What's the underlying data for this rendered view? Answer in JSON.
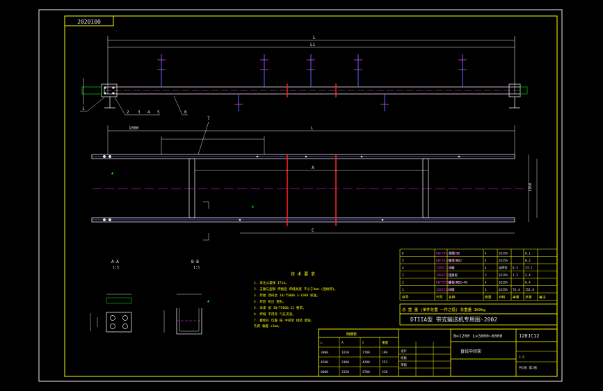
{
  "drawing": {
    "code_box": "2020100",
    "main_title": "DTIIA型  带式输送机专用图-2002",
    "sub_title": "B=1200 L=3000~6000",
    "drawing_no": "120JC12",
    "part_name": "直线中间架",
    "weight_row": "总  重  量  (单件总重  一件之值)  总重量  189kg",
    "scale_label": "1:5",
    "notes_title": "技  术  要  求",
    "revision_title": "明细表"
  },
  "views": {
    "section_a": "A-A",
    "section_b": "B-B",
    "section_a_scale": "1:5",
    "section_b_scale": "1:5",
    "dim_top_L": "L",
    "dim_top_L1": "L1",
    "dim_plan_L": "L",
    "dim_plan_A": "A",
    "dim_plan_C": "C",
    "dim_plan_B": "1050",
    "dim_plan_left": "1000",
    "dim_plan_right": "1000"
  },
  "callouts": [
    "1",
    "2",
    "3",
    "4",
    "5",
    "6",
    "7"
  ],
  "notes": [
    "1. 未注公差按 IT14。",
    "2. 支腿与型钢  焊接后  焊缝高度  不小于4mm  (连续焊)。",
    "3. 焊接  须符合  JB/T5000.3-1998  标准。",
    "4. 焊后  校正  变形。",
    "5. 涂漆  按  JB/T5000.12  要求。",
    "6. 焊缝  不得有  气孔夹渣。",
    "7. 螺栓孔  位置  按  中间架  组装  配钻,",
    "   孔距  偏差  ±1mm。"
  ],
  "parts_table": {
    "headers": [
      "序号",
      "代号",
      "名称",
      "数量",
      "材料",
      "单重",
      "总重",
      "备注"
    ],
    "rows": [
      [
        "6",
        "GB/T97.1-2002",
        "垫圈 12",
        "4",
        "Q235A",
        "",
        "0.1",
        ""
      ],
      [
        "5",
        "GB/T6170-2000",
        "螺母 M12",
        "4",
        "Q235A",
        "",
        "0.2",
        ""
      ],
      [
        "4",
        "120JC12-04",
        "支腿",
        "4",
        "组焊件",
        "8.3",
        "33.2",
        ""
      ],
      [
        "3",
        "120JC12-03",
        "连接板",
        "2",
        "Q235A",
        "1.2",
        "2.4",
        ""
      ],
      [
        "2",
        "GB/T5780-2000",
        "螺栓 M12×40",
        "4",
        "Q235A",
        "",
        "0.4",
        ""
      ],
      [
        "1",
        "120JC12-01",
        "纵梁",
        "2",
        "Q235A",
        "76.4",
        "152.8",
        ""
      ]
    ]
  },
  "revision_rows": [
    [
      "L",
      "A",
      "C",
      "重量"
    ],
    [
      "3000",
      "1650",
      "2700",
      "189"
    ],
    [
      "4500",
      "2400",
      "4200",
      "253"
    ],
    [
      "6000",
      "3150",
      "5700",
      "318"
    ]
  ],
  "title_block": {
    "design": "设计",
    "check": "校核",
    "approve": "审核",
    "sheet": "共1张  第1张"
  }
}
